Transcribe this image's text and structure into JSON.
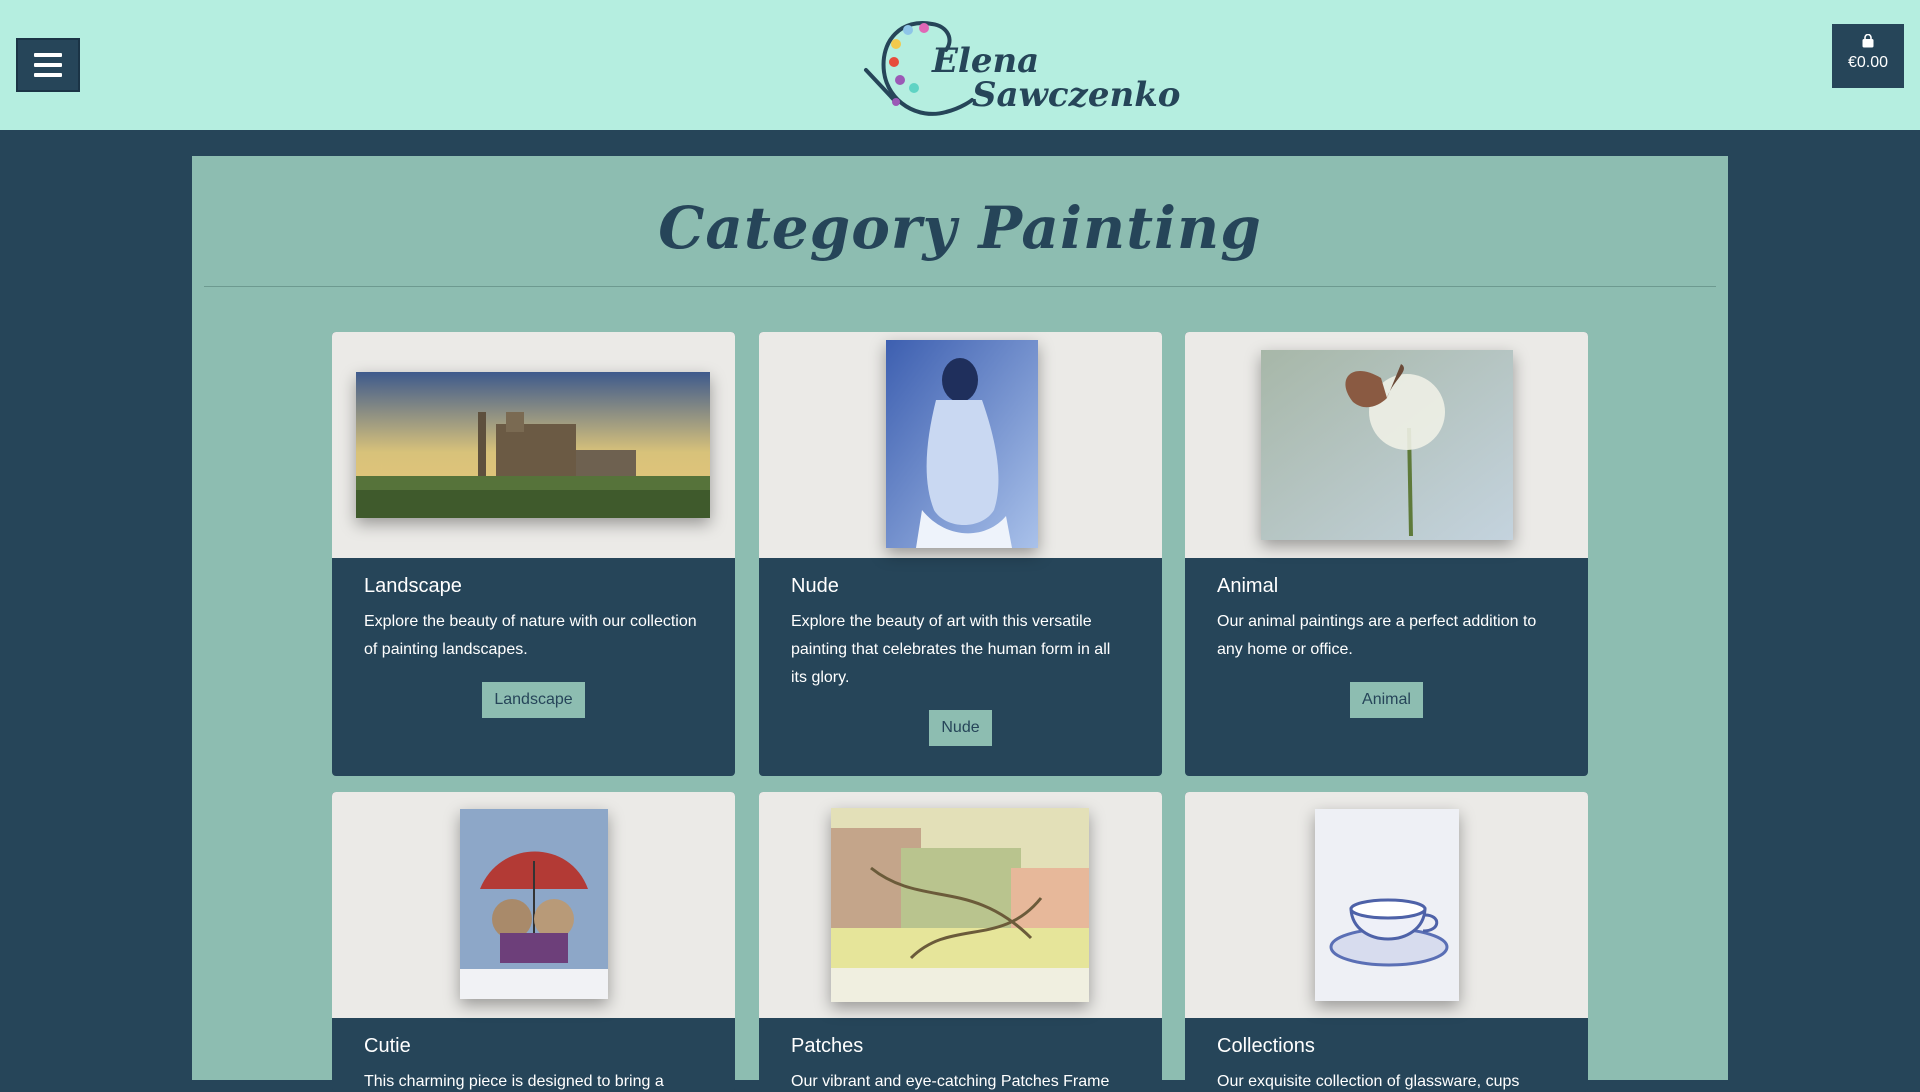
{
  "header": {
    "logo_first": "Elena",
    "logo_last": "Sawczenko",
    "cart_total": "€0.00",
    "menu_icon": "hamburger-icon",
    "cart_icon": "shopping-bag-icon"
  },
  "page": {
    "title": "Category Painting"
  },
  "colors": {
    "header_bg": "#b5eee0",
    "body_bg": "#264559",
    "panel_bg": "#8dbdb1",
    "card_bg": "#264559",
    "button_bg": "#8dbdb1"
  },
  "categories": [
    {
      "title": "Landscape",
      "description": "Explore the beauty of nature with our collection of painting landscapes.",
      "button": "Landscape"
    },
    {
      "title": "Nude",
      "description": "Explore the beauty of art with this versatile painting that celebrates the human form in all its glory.",
      "button": "Nude"
    },
    {
      "title": "Animal",
      "description": "Our animal paintings are a perfect addition to any home or office.",
      "button": "Animal"
    },
    {
      "title": "Cutie",
      "description": "This charming piece is designed to bring a"
    },
    {
      "title": "Patches",
      "description": "Our vibrant and eye-catching Patches Frame"
    },
    {
      "title": "Collections",
      "description": "Our exquisite collection of glassware, cups"
    }
  ]
}
